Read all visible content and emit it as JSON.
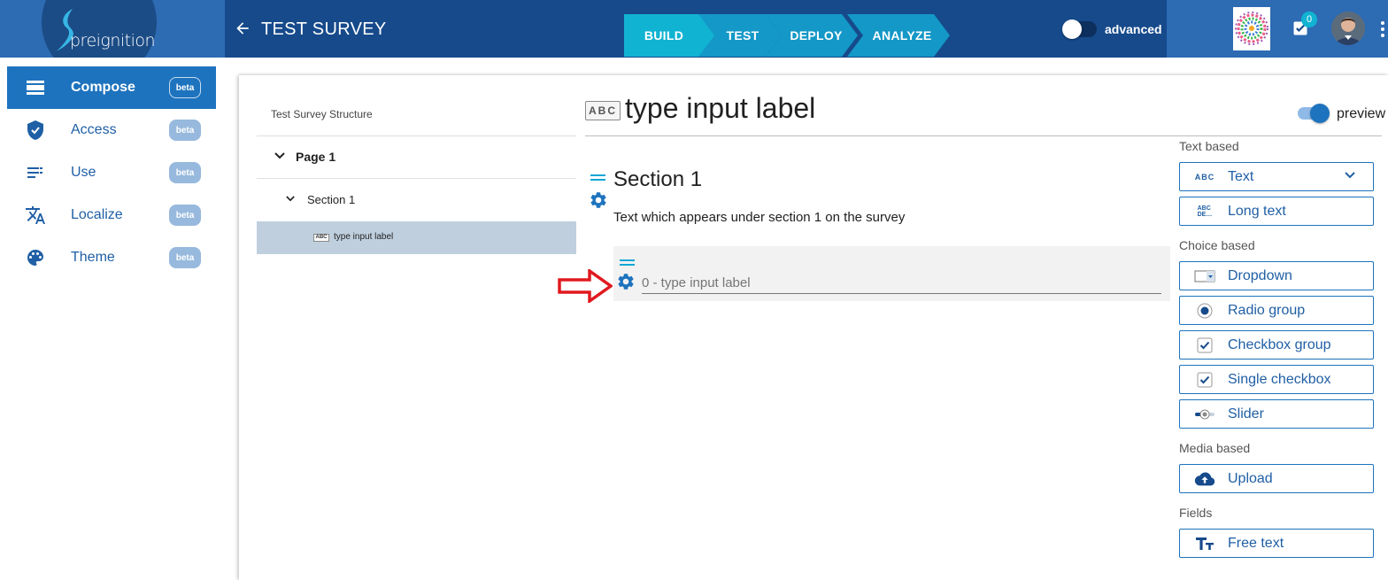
{
  "header": {
    "logo_text": "preignition",
    "survey_title": "TEST SURVEY",
    "steps": [
      "BUILD",
      "TEST",
      "DEPLOY",
      "ANALYZE"
    ],
    "advanced_label": "advanced",
    "tasks_count": "0",
    "colors": {
      "bar": "#164a8b",
      "active_step": "#11b3d2",
      "step": "#1498c7"
    }
  },
  "sidebar": {
    "items": [
      {
        "label": "Compose",
        "badge": "beta",
        "icon": "compose-icon",
        "active": true
      },
      {
        "label": "Access",
        "badge": "beta",
        "icon": "shield-icon",
        "active": false
      },
      {
        "label": "Use",
        "badge": "beta",
        "icon": "list-icon",
        "active": false
      },
      {
        "label": "Localize",
        "badge": "beta",
        "icon": "translate-icon",
        "active": false
      },
      {
        "label": "Theme",
        "badge": "beta",
        "icon": "palette-icon",
        "active": false
      }
    ]
  },
  "structure": {
    "title": "Test Survey Structure",
    "page_label": "Page 1",
    "section_label": "Section 1",
    "question_icon": "ABC",
    "question_label": "type input label"
  },
  "editor": {
    "type_icon": "ABC",
    "title": "type input label",
    "preview_label": "preview",
    "section_title": "Section 1",
    "section_description": "Text which appears under section 1 on the survey",
    "question_placeholder": "0 - type input label"
  },
  "palette": {
    "groups": [
      {
        "heading": "Text based",
        "items": [
          {
            "label": "Text",
            "icon": "abc-icon"
          },
          {
            "label": "Long text",
            "icon": "long-text-icon"
          }
        ]
      },
      {
        "heading": "Choice based",
        "items": [
          {
            "label": "Dropdown",
            "icon": "dropdown-icon"
          },
          {
            "label": "Radio group",
            "icon": "radio-icon"
          },
          {
            "label": "Checkbox group",
            "icon": "checkbox-icon"
          },
          {
            "label": "Single checkbox",
            "icon": "checkbox-icon"
          },
          {
            "label": "Slider",
            "icon": "slider-icon"
          }
        ]
      },
      {
        "heading": "Media based",
        "items": [
          {
            "label": "Upload",
            "icon": "cloud-upload-icon"
          }
        ]
      },
      {
        "heading": "Fields",
        "items": [
          {
            "label": "Free text",
            "icon": "text-fields-icon"
          }
        ]
      }
    ]
  }
}
